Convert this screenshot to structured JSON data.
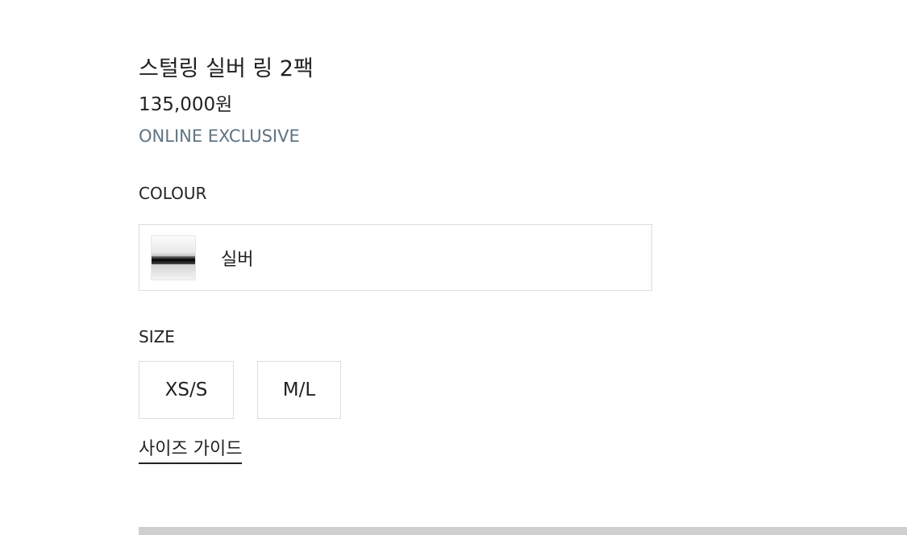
{
  "product": {
    "title": "스털링 실버 링 2팩",
    "price": "135,000원",
    "badge": "ONLINE EXCLUSIVE"
  },
  "colour": {
    "label": "COLOUR",
    "selected": "실버"
  },
  "size": {
    "label": "SIZE",
    "options": [
      "XS/S",
      "M/L"
    ],
    "guide": "사이즈 가이드"
  }
}
